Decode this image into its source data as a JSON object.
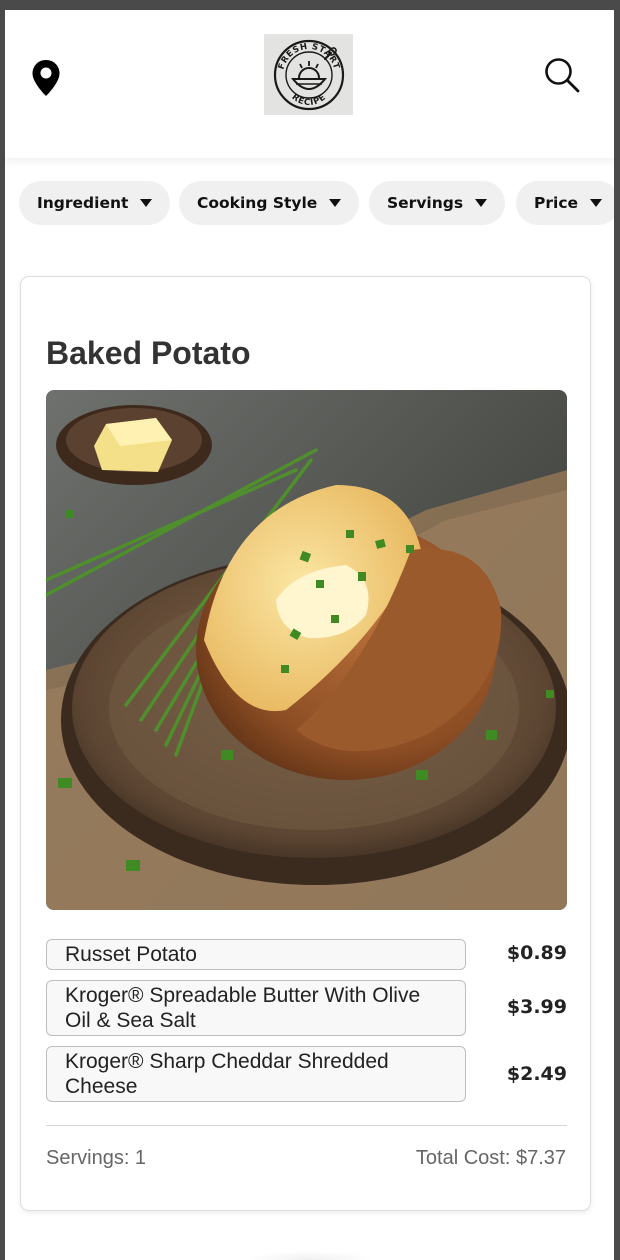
{
  "header": {
    "logo_text": "FRESH START RECIPE",
    "location_icon": "map-pin-icon",
    "search_icon": "search-icon"
  },
  "filters": [
    {
      "label": "Ingredient"
    },
    {
      "label": "Cooking Style"
    },
    {
      "label": "Servings"
    },
    {
      "label": "Price"
    }
  ],
  "recipe": {
    "title": "Baked Potato",
    "ingredients": [
      {
        "name": "Russet Potato",
        "price": "$0.89"
      },
      {
        "name": "Kroger® Spreadable Butter With Olive Oil & Sea Salt",
        "price": "$3.99"
      },
      {
        "name": "Kroger® Sharp Cheddar Shredded Cheese",
        "price": "$2.49"
      }
    ],
    "servings": "Servings: 1",
    "total_cost": "Total Cost: $7.37"
  }
}
